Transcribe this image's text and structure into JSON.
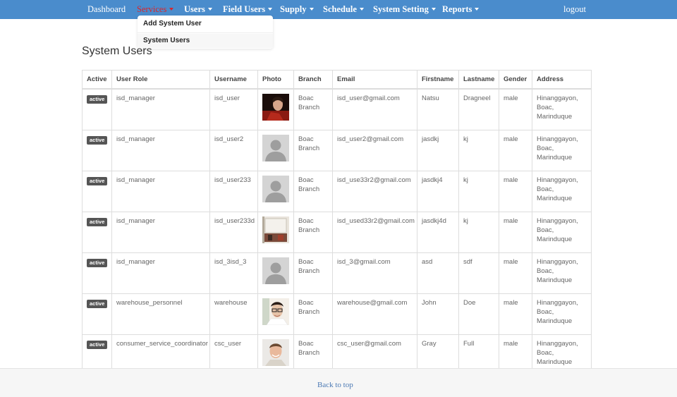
{
  "navbar": {
    "items": [
      {
        "label": "Dashboard"
      },
      {
        "label": "Services"
      },
      {
        "label": "Users"
      },
      {
        "label": "Field Users"
      },
      {
        "label": "Supply"
      },
      {
        "label": "Schedule"
      },
      {
        "label": "System Setting"
      },
      {
        "label": "Reports"
      }
    ],
    "logout_label": "logout",
    "bar_color": "#4a8ccc",
    "active_color": "#d9262c"
  },
  "users_dropdown": {
    "items": [
      {
        "label": "Add System User"
      },
      {
        "label": "System Users"
      }
    ]
  },
  "page_title": "System Users",
  "table": {
    "headers": [
      "Active",
      "User Role",
      "Username",
      "Photo",
      "Branch",
      "Email",
      "Firstname",
      "Lastname",
      "Gender",
      "Address"
    ],
    "rows": [
      {
        "status": "active",
        "role": "isd_manager",
        "username": "isd_user",
        "photo": "user-photo-red-jacket",
        "branch": "Boac Branch",
        "email": "isd_user@gmail.com",
        "firstname": "Natsu",
        "lastname": "Dragneel",
        "gender": "male",
        "address": "Hinanggayon, Boac, Marinduque"
      },
      {
        "status": "active",
        "role": "isd_manager",
        "username": "isd_user2",
        "photo": "default-avatar",
        "branch": "Boac Branch",
        "email": "isd_user2@gmail.com",
        "firstname": "jasdkj",
        "lastname": "kj",
        "gender": "male",
        "address": "Hinanggayon, Boac, Marinduque"
      },
      {
        "status": "active",
        "role": "isd_manager",
        "username": "isd_user233",
        "photo": "default-avatar",
        "branch": "Boac Branch",
        "email": "isd_use33r2@gmail.com",
        "firstname": "jasdkj4",
        "lastname": "kj",
        "gender": "male",
        "address": "Hinanggayon, Boac, Marinduque"
      },
      {
        "status": "active",
        "role": "isd_manager",
        "username": "isd_user233d",
        "photo": "user-photo-room",
        "branch": "Boac Branch",
        "email": "isd_used33r2@gmail.com",
        "firstname": "jasdkj4d",
        "lastname": "kj",
        "gender": "male",
        "address": "Hinanggayon, Boac, Marinduque"
      },
      {
        "status": "active",
        "role": "isd_manager",
        "username": "isd_3isd_3",
        "photo": "default-avatar",
        "branch": "Boac Branch",
        "email": "isd_3@gmail.com",
        "firstname": "asd",
        "lastname": "sdf",
        "gender": "male",
        "address": "Hinanggayon, Boac, Marinduque"
      },
      {
        "status": "active",
        "role": "warehouse_personnel",
        "username": "warehouse",
        "photo": "user-photo-glasses",
        "branch": "Boac Branch",
        "email": "warehouse@gmail.com",
        "firstname": "John",
        "lastname": "Doe",
        "gender": "male",
        "address": "Hinanggayon, Boac, Marinduque"
      },
      {
        "status": "active",
        "role": "consumer_service_coordinator",
        "username": "csc_user",
        "photo": "user-photo-smiling",
        "branch": "Boac Branch",
        "email": "csc_user@gmail.com",
        "firstname": "Gray",
        "lastname": "Full",
        "gender": "male",
        "address": "Hinanggayon, Boac, Marinduque"
      }
    ]
  },
  "footer": {
    "back_to_top": "Back to top"
  }
}
